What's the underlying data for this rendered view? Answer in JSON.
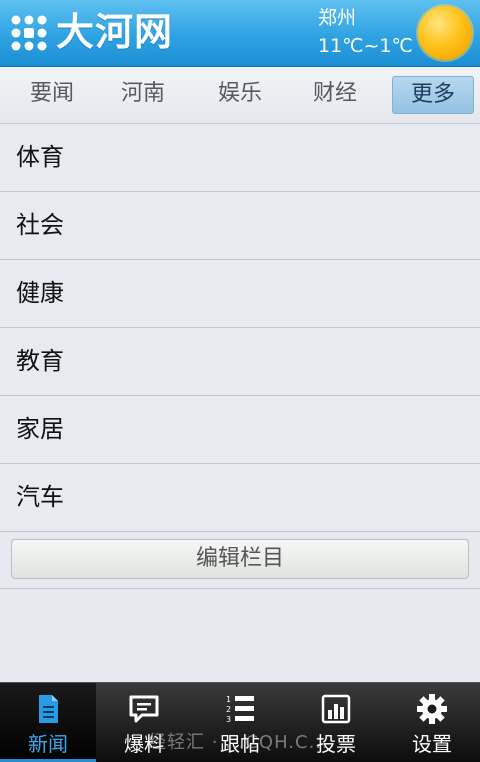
{
  "header": {
    "logo_text": "大河网",
    "weather_city": "郑州",
    "weather_temp": "11℃~1℃",
    "weather_icon": "sun-icon"
  },
  "tabs": [
    {
      "label": "要闻",
      "active": false
    },
    {
      "label": "河南",
      "active": false
    },
    {
      "label": "娱乐",
      "active": false
    },
    {
      "label": "财经",
      "active": false
    },
    {
      "label": "更多",
      "active": true
    }
  ],
  "categories": [
    {
      "label": "体育"
    },
    {
      "label": "社会"
    },
    {
      "label": "健康"
    },
    {
      "label": "教育"
    },
    {
      "label": "家居"
    },
    {
      "label": "汽车"
    }
  ],
  "edit_button": {
    "label": "编辑栏目"
  },
  "bottom_nav": [
    {
      "label": "新闻",
      "icon": "document-icon",
      "active": true
    },
    {
      "label": "爆料",
      "icon": "chat-bubble-icon",
      "active": false
    },
    {
      "label": "跟帖",
      "icon": "numbered-list-icon",
      "active": false
    },
    {
      "label": "投票",
      "icon": "bar-chart-icon",
      "active": false
    },
    {
      "label": "设置",
      "icon": "gear-icon",
      "active": false
    }
  ],
  "watermark": "经轻汇 · ...CQH.C...",
  "colors": {
    "header_blue": "#2fa3e2",
    "active_nav": "#3aa7ec",
    "background": "#e6e9ef"
  }
}
